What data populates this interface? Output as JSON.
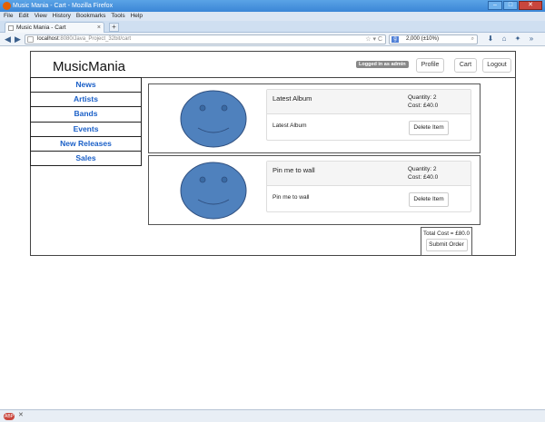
{
  "browser": {
    "window_title": "Music Mania - Cart - Mozilla Firefox",
    "window_buttons": [
      "–",
      "□",
      "✕"
    ],
    "menu": [
      "File",
      "Edit",
      "View",
      "History",
      "Bookmarks",
      "Tools",
      "Help"
    ],
    "tab_title": "Music Mania - Cart",
    "new_tab": "+",
    "url_host": "localhost",
    "url_rest": ":8080/Java_Project_32bit/cart",
    "url_icons": "☆ ▾ C",
    "search_engine": "g",
    "search_value": "2,000 (±10%)",
    "search_icon": "⌕"
  },
  "site": {
    "brand": "MusicMania",
    "badge": "Logged in as admin",
    "header_buttons": {
      "profile": "Profile",
      "cart": "Cart",
      "logout": "Logout"
    },
    "sidebar": [
      "News",
      "Artists",
      "Bands",
      "Events",
      "New Releases",
      "Sales"
    ],
    "cart_items": [
      {
        "title": "Latest Album",
        "quantity": "Quantity: 2",
        "cost": "Cost: £40.0",
        "description": "Latest Album",
        "delete_label": "Delete Item"
      },
      {
        "title": "Pin me to wall",
        "quantity": "Quantity: 2",
        "cost": "Cost: £40.0",
        "description": "Pin me to wall",
        "delete_label": "Delete Item"
      }
    ],
    "total": "Total Cost = £80.0",
    "submit_label": "Submit Order"
  },
  "colors": {
    "link": "#1a5fc7",
    "smiley_fill": "#4f81bd",
    "smiley_stroke": "#2f4f7f"
  }
}
